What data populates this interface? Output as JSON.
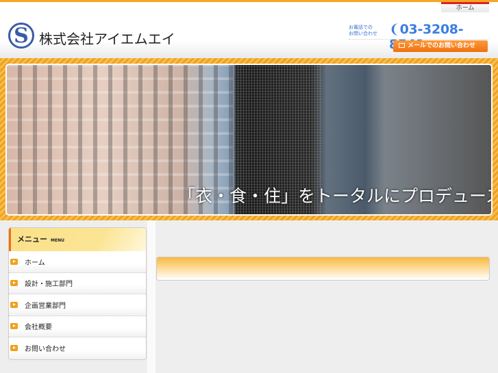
{
  "header": {
    "home_link": "ホーム",
    "logo_letter": "S",
    "company_name": "株式会社アイエムエイ",
    "tel_label_1": "お電話での",
    "tel_label_2": "お問い合わせ",
    "tel_number": "03-3208-8541",
    "mail_button": "メールでのお問い合わせ"
  },
  "banner": {
    "caption": "「衣・食・住」をトータルにプロデュース・"
  },
  "menu": {
    "title": "メニュー",
    "title_en": "MENU",
    "items": [
      {
        "label": "ホーム"
      },
      {
        "label": "設計・施工部門"
      },
      {
        "label": "企画営業部門"
      },
      {
        "label": "会社概要"
      },
      {
        "label": "お問い合わせ"
      }
    ]
  },
  "colors": {
    "accent": "#f5a623",
    "button": "#f07010",
    "tel": "#3a7ee0"
  }
}
